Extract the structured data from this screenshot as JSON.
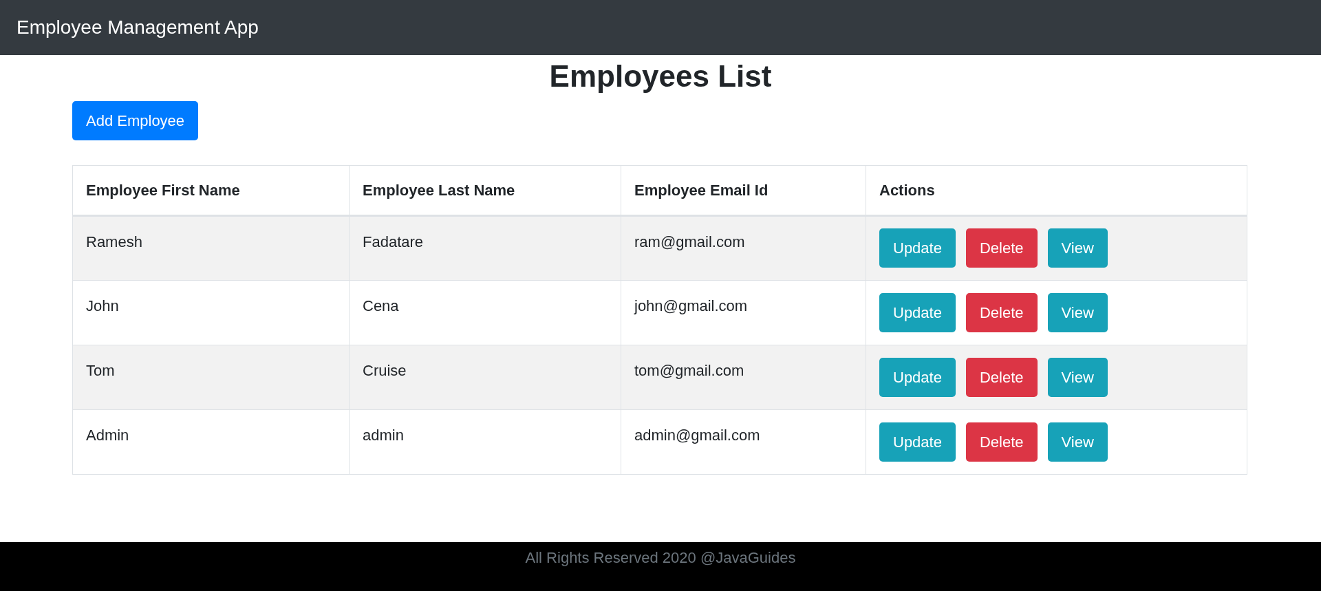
{
  "navbar": {
    "brand": "Employee Management App"
  },
  "page": {
    "title": "Employees List",
    "add_button": "Add Employee"
  },
  "table": {
    "columns": [
      "Employee First Name",
      "Employee Last Name",
      "Employee Email Id",
      "Actions"
    ],
    "rows": [
      {
        "first_name": "Ramesh",
        "last_name": "Fadatare",
        "email": "ram@gmail.com",
        "actions": [
          {
            "kind": "update",
            "label": "Update"
          },
          {
            "kind": "delete",
            "label": "Delete"
          },
          {
            "kind": "view",
            "label": "View"
          }
        ]
      },
      {
        "first_name": "John",
        "last_name": "Cena",
        "email": "john@gmail.com",
        "actions": [
          {
            "kind": "update",
            "label": "Update"
          },
          {
            "kind": "delete",
            "label": "Delete"
          },
          {
            "kind": "view",
            "label": "View"
          }
        ]
      },
      {
        "first_name": "Tom",
        "last_name": "Cruise",
        "email": "tom@gmail.com",
        "actions": [
          {
            "kind": "update",
            "label": "Update"
          },
          {
            "kind": "delete",
            "label": "Delete"
          },
          {
            "kind": "view",
            "label": "View"
          }
        ]
      },
      {
        "first_name": "Admin",
        "last_name": "admin",
        "email": "admin@gmail.com",
        "actions": [
          {
            "kind": "update",
            "label": "Update"
          },
          {
            "kind": "delete",
            "label": "Delete"
          },
          {
            "kind": "view",
            "label": "View"
          }
        ]
      }
    ]
  },
  "footer": {
    "text": "All Rights Reserved 2020 @JavaGuides"
  }
}
